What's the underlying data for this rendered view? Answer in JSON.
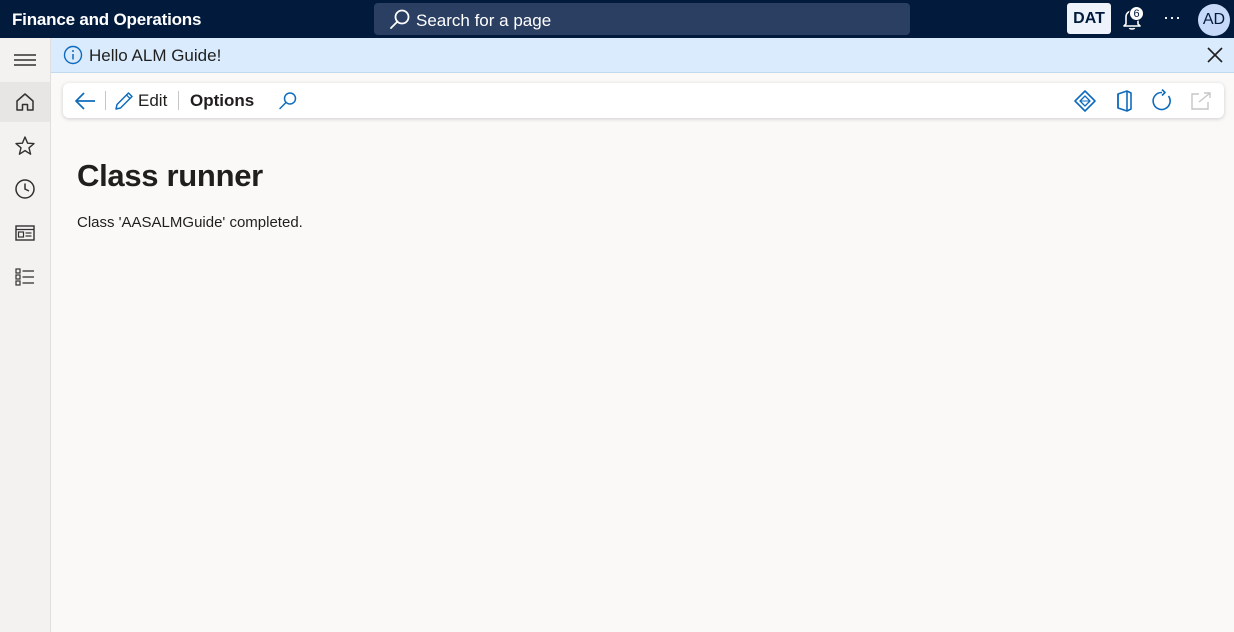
{
  "app": {
    "title": "Finance and Operations"
  },
  "search": {
    "placeholder": "Search for a page"
  },
  "header": {
    "company": "DAT",
    "notification_count": "6",
    "more_label": "⋯",
    "user_initials": "AD"
  },
  "nav": {
    "items": [
      {
        "icon": "hamburger-icon"
      },
      {
        "icon": "home-icon"
      },
      {
        "icon": "star-icon"
      },
      {
        "icon": "clock-icon"
      },
      {
        "icon": "workspace-icon"
      },
      {
        "icon": "list-icon"
      }
    ]
  },
  "infobar": {
    "message": "Hello ALM Guide!"
  },
  "actionpane": {
    "edit_label": "Edit",
    "options_label": "Options"
  },
  "page": {
    "title": "Class runner",
    "message": "Class 'AASALMGuide' completed."
  },
  "colors": {
    "topbar": "#021b3c",
    "accent": "#0f6cbd",
    "infobar": "#d9ebfd",
    "background": "#faf9f8"
  }
}
